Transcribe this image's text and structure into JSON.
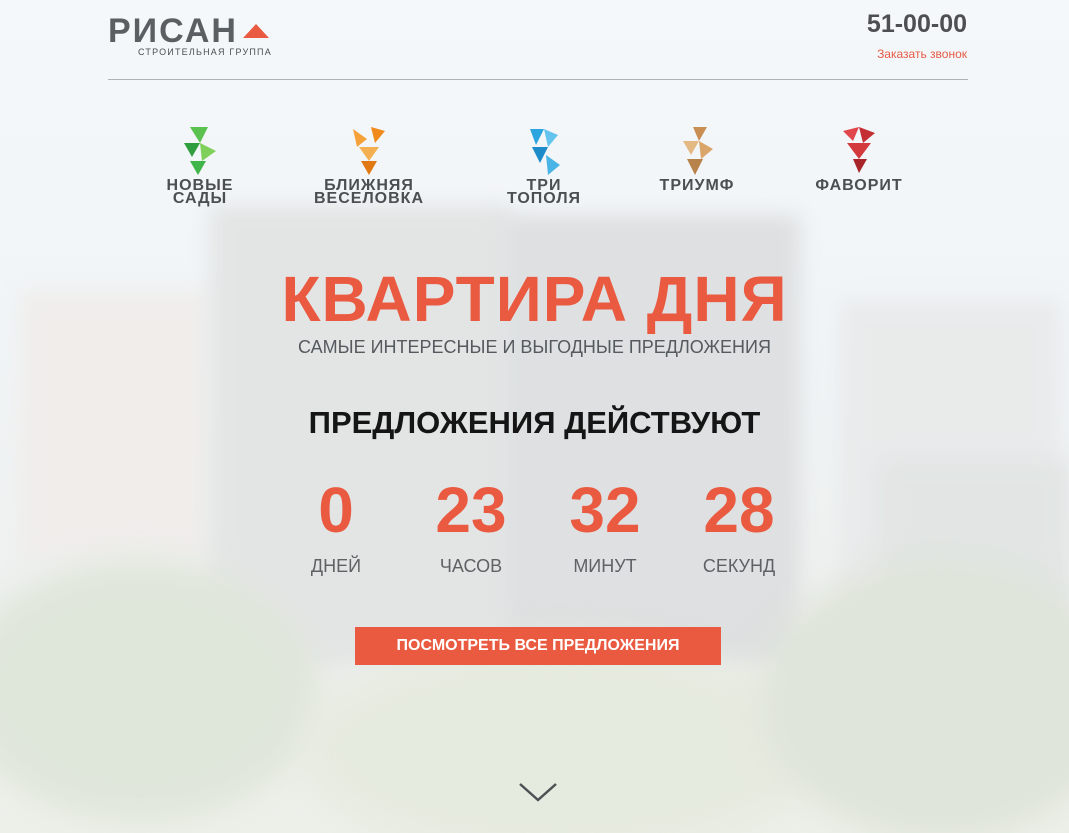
{
  "header": {
    "logo_word": "РИСАН",
    "logo_sub": "СТРОИТЕЛЬНАЯ ГРУППА",
    "phone": "51-00-00",
    "callback": "Заказать звонок"
  },
  "projects": [
    {
      "name": "НОВЫЕ\nСАДЫ",
      "color": "#3fb54a",
      "icon": "novye-sady-logo-icon"
    },
    {
      "name": "БЛИЖНЯЯ\nВЕСЕЛОВКА",
      "color": "#f08a1c",
      "icon": "blizhnyaya-veselovka-logo-icon"
    },
    {
      "name": "ТРИ\nТОПОЛЯ",
      "color": "#2aa5df",
      "icon": "tri-topolya-logo-icon"
    },
    {
      "name": "ТРИУМФ",
      "color": "#d9a56a",
      "icon": "triumf-logo-icon"
    },
    {
      "name": "ФАВОРИТ",
      "color": "#d23a3e",
      "icon": "favorit-logo-icon"
    }
  ],
  "hero": {
    "title": "КВАРТИРА ДНЯ",
    "subtitle": "САМЫЕ ИНТЕРЕСНЫЕ И ВЫГОДНЫЕ ПРЕДЛОЖЕНИЯ",
    "valid_label": "ПРЕДЛОЖЕНИЯ ДЕЙСТВУЮТ"
  },
  "countdown": [
    {
      "value": "0",
      "label": "ДНЕЙ"
    },
    {
      "value": "23",
      "label": "ЧАСОВ"
    },
    {
      "value": "32",
      "label": "МИНУТ"
    },
    {
      "value": "28",
      "label": "СЕКУНД"
    }
  ],
  "cta_label": "ПОСМОТРЕТЬ ВСЕ ПРЕДЛОЖЕНИЯ",
  "colors": {
    "accent": "#ea5a41",
    "text_dark": "#151515",
    "text_gray": "#555a5e"
  }
}
